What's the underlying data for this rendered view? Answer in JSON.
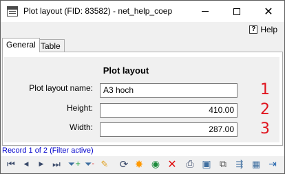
{
  "window": {
    "title": "Plot layout (FID: 83582) - net_help_coep"
  },
  "menu": {
    "help_label": "Help"
  },
  "tabs": [
    {
      "label": "General"
    },
    {
      "label": "Table"
    }
  ],
  "form": {
    "title": "Plot layout",
    "fields": [
      {
        "label": "Plot layout name:",
        "value": "A3 hoch",
        "marker": "1"
      },
      {
        "label": "Height:",
        "value": "410.00",
        "marker": "2"
      },
      {
        "label": "Width:",
        "value": "287.00",
        "marker": "3"
      }
    ]
  },
  "status": {
    "record_text": "Record 1 of 2 (Filter active)"
  },
  "colors": {
    "marker": "#e0141e",
    "record_text": "#0000cc"
  },
  "toolbar_icons": [
    "first-record-icon",
    "previous-record-icon",
    "next-record-icon",
    "last-record-icon",
    "add-filter-icon",
    "remove-filter-icon",
    "edit-pencil-icon",
    "refresh-icon",
    "star-icon",
    "zoom-to-feature-icon",
    "delete-icon",
    "print-icon",
    "select-icon",
    "copy-icon",
    "move-icon",
    "table-icon",
    "exit-icon"
  ]
}
